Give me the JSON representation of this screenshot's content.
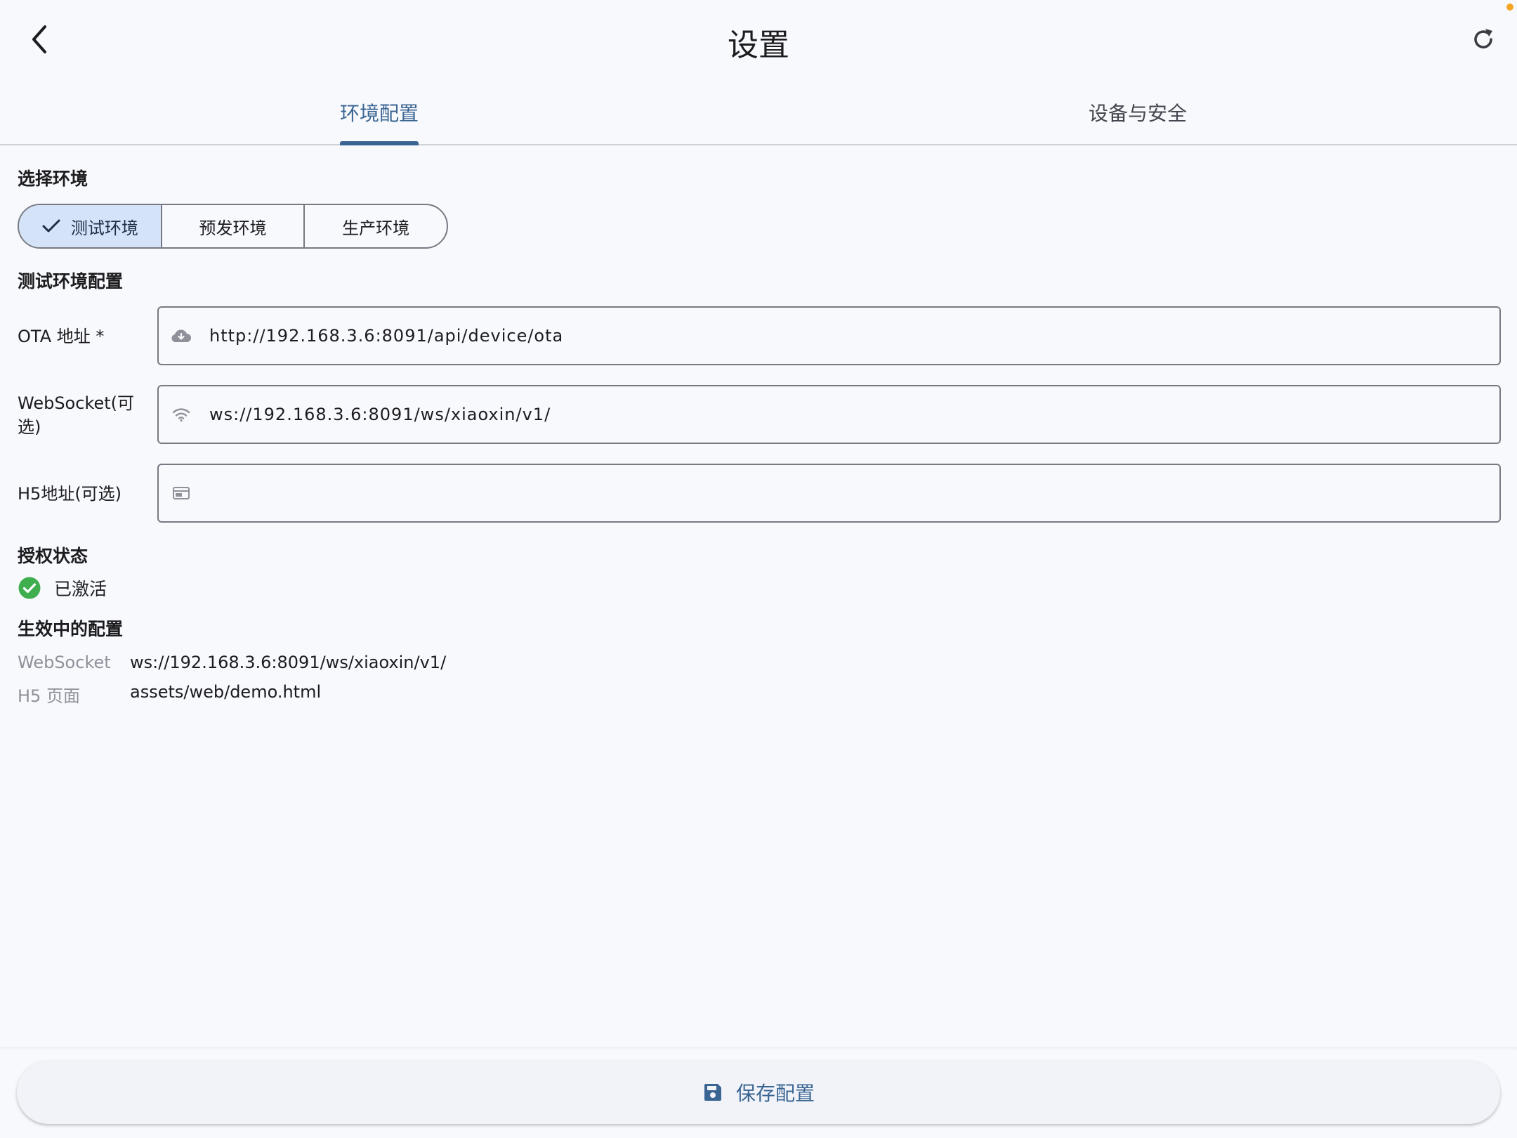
{
  "header": {
    "title": "设置",
    "back_icon": "chevron-left-icon",
    "refresh_icon": "refresh-icon",
    "accent": "#3a6592"
  },
  "tabs": [
    {
      "label": "环境配置",
      "selected": true
    },
    {
      "label": "设备与安全",
      "selected": false
    }
  ],
  "env_select": {
    "title": "选择环境",
    "options": [
      {
        "label": "测试环境",
        "selected": true
      },
      {
        "label": "预发环境",
        "selected": false
      },
      {
        "label": "生产环境",
        "selected": false
      }
    ]
  },
  "config": {
    "title": "测试环境配置",
    "ota": {
      "label": "OTA 地址 *",
      "value": "http://192.168.3.6:8091/api/device/ota",
      "icon": "cloud-download-icon"
    },
    "websocket": {
      "label_line1": "WebSocket(可",
      "label_line2": "选)",
      "value": "ws://192.168.3.6:8091/ws/xiaoxin/v1/",
      "icon": "wifi-icon"
    },
    "h5": {
      "label": "H5地址(可选)",
      "value": "",
      "icon": "web-window-icon"
    }
  },
  "auth": {
    "title": "授权状态",
    "status": "已激活",
    "status_color": "#3fae4f"
  },
  "effective": {
    "title": "生效中的配置",
    "rows": [
      {
        "key": "WebSocket",
        "value": "ws://192.168.3.6:8091/ws/xiaoxin/v1/"
      },
      {
        "key": "H5 页面",
        "value": "assets/web/demo.html"
      }
    ]
  },
  "save": {
    "label": "保存配置",
    "icon": "save-icon"
  }
}
